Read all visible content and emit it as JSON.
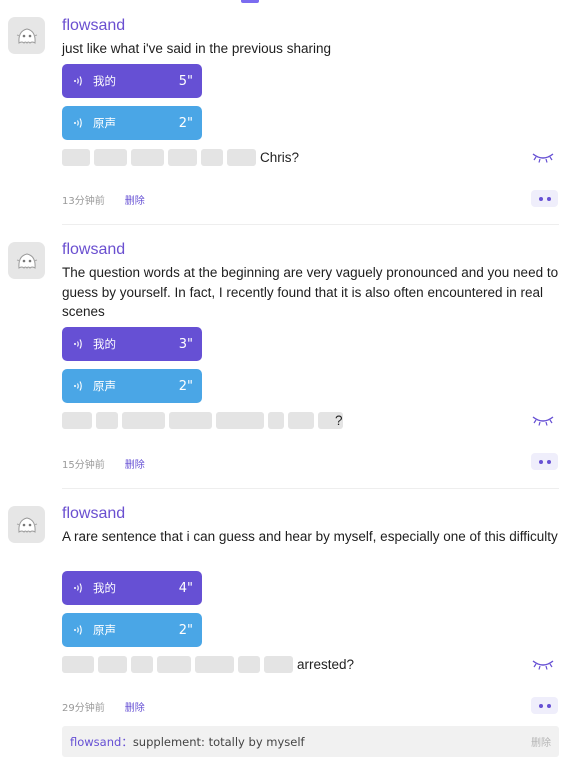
{
  "posts": [
    {
      "username": "flowsand",
      "text": "just like what i've said in the previous sharing",
      "my_voice": {
        "label": "我的",
        "duration": "5\""
      },
      "orig_voice": {
        "label": "原声",
        "duration": "2\""
      },
      "answer_tail": "Chris?",
      "time": "13分钟前",
      "delete": "删除"
    },
    {
      "username": "flowsand",
      "text": "The question words at the beginning are very vaguely pronounced and you need to guess by yourself. In fact, I recently found that it is also often encountered in real scenes",
      "my_voice": {
        "label": "我的",
        "duration": "3\""
      },
      "orig_voice": {
        "label": "原声",
        "duration": "2\""
      },
      "answer_tail": "?",
      "time": "15分钟前",
      "delete": "删除"
    },
    {
      "username": "flowsand",
      "text": "A rare sentence that i can guess and hear by myself, especially one of this difficulty",
      "my_voice": {
        "label": "我的",
        "duration": "4\""
      },
      "orig_voice": {
        "label": "原声",
        "duration": "2\""
      },
      "answer_tail": "arrested?",
      "time": "29分钟前",
      "delete": "删除",
      "comment": {
        "user": "flowsand",
        "separator": "：",
        "text": "supplement: totally by myself",
        "delete": "删除"
      }
    }
  ],
  "colors": {
    "accent": "#6650d4",
    "original_voice": "#4aa6e6",
    "blank": "#e4e4e4"
  },
  "icons": {
    "avatar": "ghost-avatar-icon",
    "voice": "sound-wave-icon",
    "reveal": "closed-eye-icon",
    "more": "more-dots-icon"
  }
}
